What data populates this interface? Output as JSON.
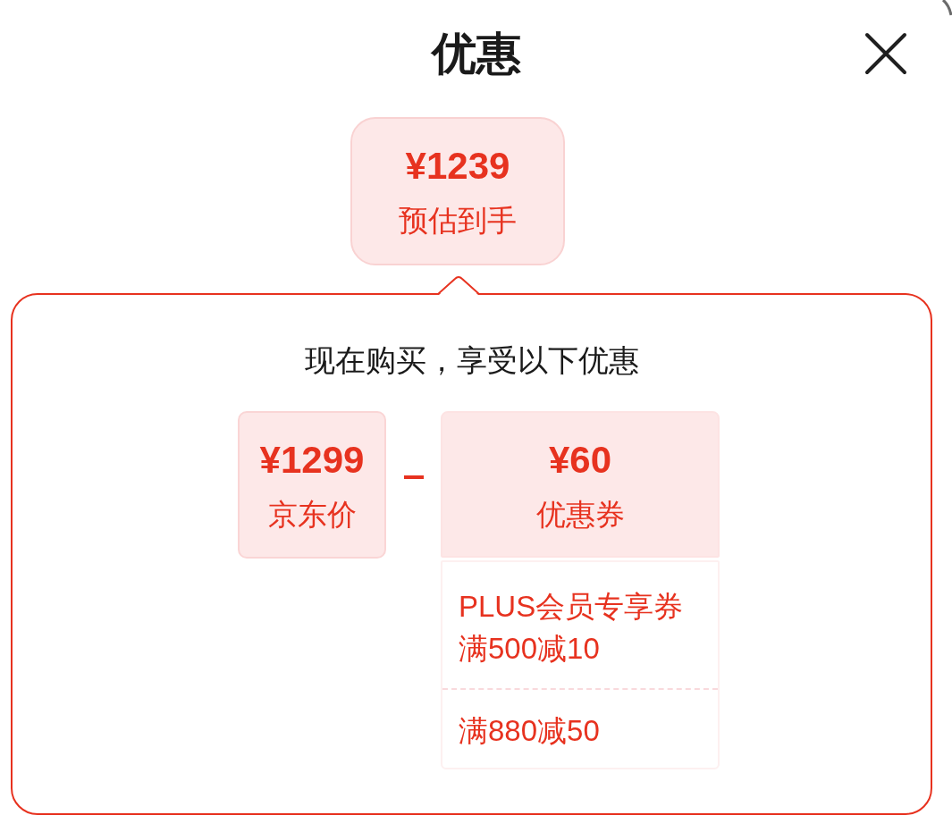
{
  "header": {
    "title": "优惠"
  },
  "estimate": {
    "price": "¥1239",
    "label": "预估到手"
  },
  "panel": {
    "heading": "现在购买，享受以下优惠",
    "base_price": {
      "price": "¥1299",
      "label": "京东价"
    },
    "discount": {
      "price": "¥60",
      "label": "优惠券"
    },
    "coupons": [
      {
        "name": "PLUS会员专享券",
        "rule": "满500减10"
      },
      {
        "rule": "满880减50"
      }
    ]
  }
}
